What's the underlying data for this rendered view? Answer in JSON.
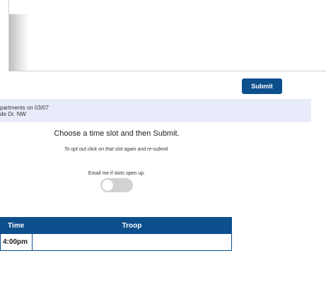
{
  "form": {
    "submit_label": "Submit"
  },
  "booth": {
    "line1": "partments on 03/07",
    "line2": "de Dr. NW"
  },
  "instructions": {
    "main": "Choose a time slot and then Submit.",
    "sub": "To opt out click on that slot again and re-submit."
  },
  "notify": {
    "label": "Email me if slots open up.",
    "enabled": false
  },
  "schedule": {
    "headers": [
      "Time",
      "Troop"
    ],
    "rows": [
      {
        "time": "4:00pm",
        "troop": ""
      }
    ]
  },
  "colors": {
    "primary": "#0d4f8c",
    "info_band": "#e8ecfa",
    "toggle_off": "#d2d2d2"
  }
}
